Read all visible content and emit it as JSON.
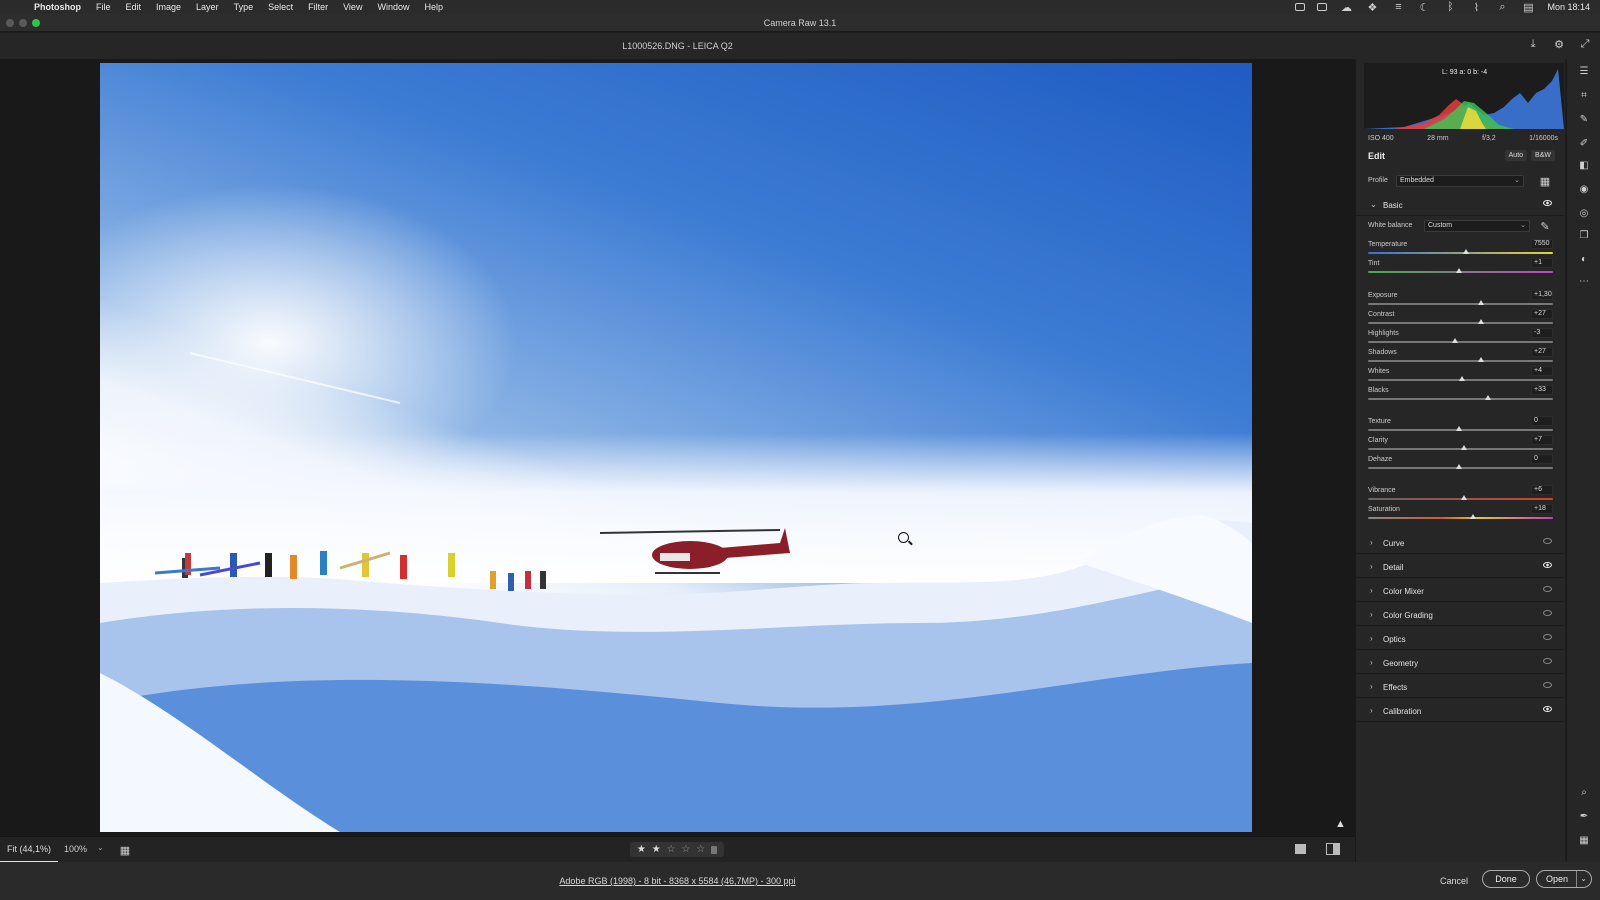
{
  "menubar": {
    "app": "Photoshop",
    "items": [
      "File",
      "Edit",
      "Image",
      "Layer",
      "Type",
      "Select",
      "Filter",
      "View",
      "Window",
      "Help"
    ],
    "clock": "Mon 18:14"
  },
  "window": {
    "title": "Camera Raw 13.1"
  },
  "document": {
    "filename": "L1000526.DNG  -  LEICA Q2"
  },
  "histogram": {
    "readout": "L: 93   a: 0     b: -4"
  },
  "exif": {
    "iso": "ISO 400",
    "focal": "28 mm",
    "aperture": "f/3,2",
    "shutter": "1/16000s"
  },
  "edit": {
    "title": "Edit",
    "auto_label": "Auto",
    "bw_label": "B&W",
    "profile_label": "Profile",
    "profile_value": "Embedded",
    "basic_label": "Basic",
    "wb_label": "White balance",
    "wb_value": "Custom",
    "sliders": {
      "temperature": {
        "label": "Temperature",
        "value": "7550",
        "position": 0.53
      },
      "tint": {
        "label": "Tint",
        "value": "+1",
        "position": 0.49
      },
      "exposure": {
        "label": "Exposure",
        "value": "+1,30",
        "position": 0.61
      },
      "contrast": {
        "label": "Contrast",
        "value": "+27",
        "position": 0.61
      },
      "highlights": {
        "label": "Highlights",
        "value": "-3",
        "position": 0.47
      },
      "shadows": {
        "label": "Shadows",
        "value": "+27",
        "position": 0.61
      },
      "whites": {
        "label": "Whites",
        "value": "+4",
        "position": 0.51
      },
      "blacks": {
        "label": "Blacks",
        "value": "+33",
        "position": 0.65
      },
      "texture": {
        "label": "Texture",
        "value": "0",
        "position": 0.49
      },
      "clarity": {
        "label": "Clarity",
        "value": "+7",
        "position": 0.52
      },
      "dehaze": {
        "label": "Dehaze",
        "value": "0",
        "position": 0.49
      },
      "vibrance": {
        "label": "Vibrance",
        "value": "+6",
        "position": 0.52
      },
      "saturation": {
        "label": "Saturation",
        "value": "+18",
        "position": 0.57
      }
    },
    "sections": [
      "Curve",
      "Detail",
      "Color Mixer",
      "Color Grading",
      "Optics",
      "Geometry",
      "Effects",
      "Calibration"
    ]
  },
  "statusbar": {
    "fit_label": "Fit (44,1%)",
    "zoom_value": "100%",
    "rating": {
      "stars": 2,
      "max": 5
    }
  },
  "bottom": {
    "info": "Adobe RGB (1998) - 8 bit - 8368 x 5584 (46,7MP) - 300 ppi",
    "cancel": "Cancel",
    "done": "Done",
    "open": "Open"
  },
  "colors": {
    "panel_bg": "#262626",
    "sky": "#2f6fcf",
    "accent": "#2ec24a"
  }
}
